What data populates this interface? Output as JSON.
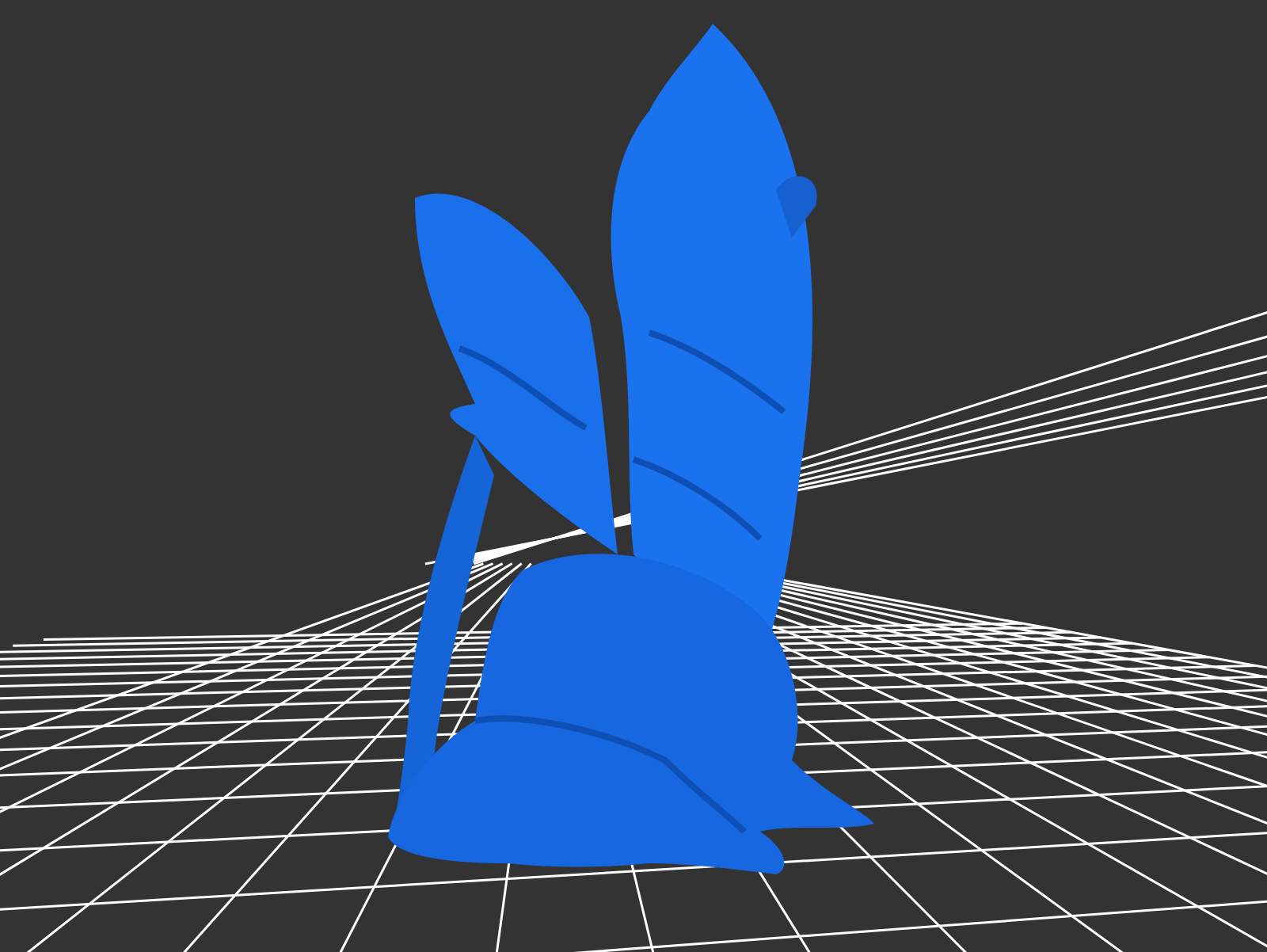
{
  "viewport": {
    "grid_visible": true,
    "model_visible": true
  }
}
